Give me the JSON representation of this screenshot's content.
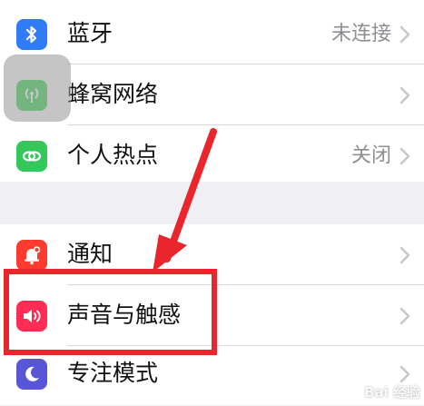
{
  "section1": {
    "items": [
      {
        "label": "蓝牙",
        "value": "未连接",
        "icon": "bluetooth-icon",
        "color": "#2f7cf6"
      },
      {
        "label": "蜂窝网络",
        "value": "",
        "icon": "cellular-icon",
        "color": "#4cd964"
      },
      {
        "label": "个人热点",
        "value": "关闭",
        "icon": "hotspot-icon",
        "color": "#34c759"
      }
    ]
  },
  "section2": {
    "items": [
      {
        "label": "通知",
        "value": "",
        "icon": "notification-icon",
        "color": "#ff3b30"
      },
      {
        "label": "声音与触感",
        "value": "",
        "icon": "sound-icon",
        "color": "#ff2d55"
      },
      {
        "label": "专注模式",
        "value": "",
        "icon": "moon-icon",
        "color": "#5856d6"
      }
    ]
  },
  "watermark": "Bai 经验",
  "annotation_color": "#e8262b"
}
